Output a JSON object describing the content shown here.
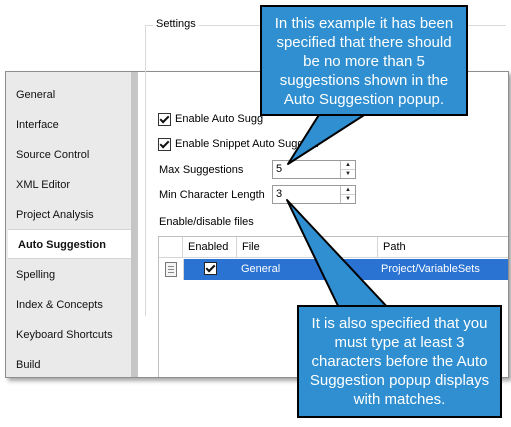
{
  "sidebar": {
    "items": [
      {
        "label": "General"
      },
      {
        "label": "Interface"
      },
      {
        "label": "Source Control"
      },
      {
        "label": "XML Editor"
      },
      {
        "label": "Project Analysis"
      },
      {
        "label": "Auto Suggestion",
        "active": true
      },
      {
        "label": "Spelling"
      },
      {
        "label": "Index & Concepts"
      },
      {
        "label": "Keyboard Shortcuts"
      },
      {
        "label": "Build"
      }
    ]
  },
  "settings": {
    "group_title": "Settings",
    "enable_auto_label": "Enable Auto Sugg",
    "enable_snippet_label": "Enable Snippet Auto Suggest",
    "max_suggestions_label": "Max Suggestions",
    "max_suggestions_value": "5",
    "min_char_label": "Min Character Length",
    "min_char_value": "3",
    "files_label": "Enable/disable files"
  },
  "table": {
    "headers": {
      "enabled": "Enabled",
      "file": "File",
      "path": "Path"
    },
    "rows": [
      {
        "enabled": true,
        "file": "General",
        "path": "Project/VariableSets"
      }
    ]
  },
  "callouts": {
    "top": "In this example it has been specified that there should be no more than 5 suggestions shown in the Auto Suggestion popup.",
    "bottom": "It is also specified that you must type at least 3 characters before the Auto Suggestion popup displays with matches."
  },
  "colors": {
    "callout_fill": "#2f8fd0",
    "selection": "#2a73d3",
    "sidebar_bg": "#eaeaea"
  },
  "icons": [
    "checkbox-checked-icon",
    "spin-up-icon",
    "spin-down-icon",
    "file-icon"
  ]
}
